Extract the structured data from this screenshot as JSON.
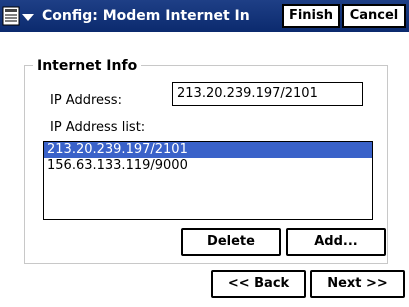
{
  "window": {
    "title": "Config: Modem Internet In",
    "finish_label": "Finish",
    "cancel_label": "Cancel"
  },
  "group": {
    "title": "Internet Info",
    "ip_address_label": "IP Address:",
    "ip_address_value": "213.20.239.197/2101",
    "ip_list_label": "IP Address list:",
    "ip_list_items": [
      "213.20.239.197/2101",
      "156.63.133.119/9000"
    ],
    "selected_index": 0
  },
  "actions": {
    "delete_label": "Delete",
    "add_label": "Add..."
  },
  "nav": {
    "back_label": "<< Back",
    "next_label": "Next >>"
  },
  "colors": {
    "titlebar": "#0b2a6e",
    "selection": "#3a62c9"
  },
  "icons": {
    "app_menu": "app-menu-icon",
    "dropdown": "caret-down-icon"
  }
}
